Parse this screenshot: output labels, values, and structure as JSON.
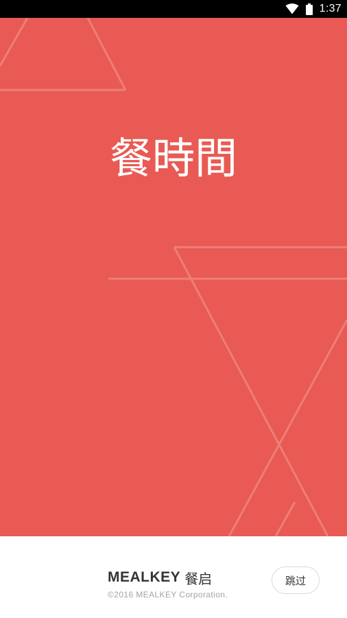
{
  "status_bar": {
    "time": "1:37",
    "icons": [
      "wifi-icon",
      "battery-icon"
    ]
  },
  "splash": {
    "logo_text": "餐時間",
    "background_color": "#e95a54"
  },
  "footer": {
    "brand_name": "MEALKEY",
    "brand_name_cn": "餐启",
    "copyright": "©2016 MEALKEY Corporation.",
    "skip_label": "跳过"
  }
}
